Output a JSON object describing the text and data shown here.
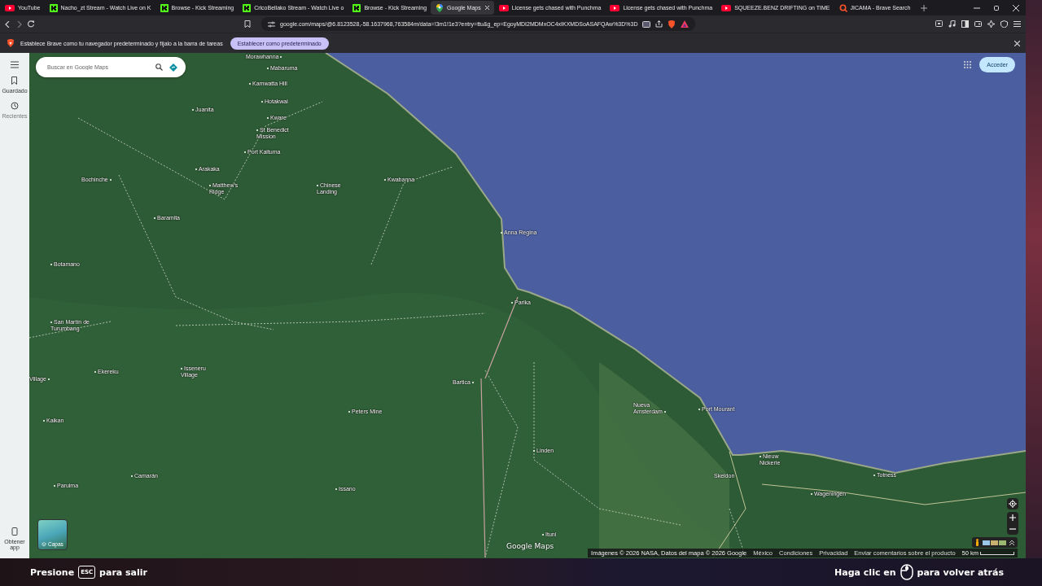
{
  "tabs": [
    {
      "label": "YouTube",
      "kind": "youtube",
      "selected": false
    },
    {
      "label": "Nacho_zt Stream - Watch Live on K",
      "kind": "kick",
      "selected": false
    },
    {
      "label": "Browse - Kick Streaming",
      "kind": "kick",
      "selected": false
    },
    {
      "label": "CricoBellako Stream - Watch Live o",
      "kind": "kick",
      "selected": false
    },
    {
      "label": "Browse - Kick Streaming",
      "kind": "kick",
      "selected": false
    },
    {
      "label": "Google Maps",
      "kind": "maps",
      "selected": true
    },
    {
      "label": "License gets chased with Punchma",
      "kind": "youtube",
      "selected": false
    },
    {
      "label": "License gets chased with Punchma",
      "kind": "youtube",
      "selected": false
    },
    {
      "label": "SQUEEZE.BENZ DRIFTING on TIME",
      "kind": "youtube",
      "selected": false
    },
    {
      "label": "JICAMA - Brave Search",
      "kind": "search",
      "selected": false
    }
  ],
  "address_bar": {
    "url": "google.com/maps/@6.8123528,-58.1637968,763584m/data=!3m1!1e3?entry=ttu&g_ep=EgoyMDI2MDMxOC4xIKXMDSoASAFQAw%3D%3D"
  },
  "infobar": {
    "message": "Establece Brave como tu navegador predeterminado y fíjalo a la barra de tareas",
    "button": "Establecer como predeterminado"
  },
  "maps": {
    "search": {
      "placeholder": "Buscar en Google Maps"
    },
    "sidebar": [
      {
        "label": "Guardado",
        "kind": "saved",
        "disabled": false
      },
      {
        "label": "Recientes",
        "kind": "recent",
        "disabled": true
      },
      {
        "label": "Obtener app",
        "kind": "app",
        "disabled": false
      }
    ],
    "sign_in": "Acceder",
    "layers": "Capas",
    "logo": "Google Maps",
    "places": [
      "Morawhanna",
      "Mabaruma",
      "Kamwatta Hill",
      "Hotakwai",
      "Kware",
      "St Benedict Mission",
      "Port Kaituma",
      "Juanita",
      "Arakaka",
      "Matthew's Ridge",
      "Chinese Landing",
      "Bochinche",
      "Baramita",
      "Kwabanna",
      "Anna Regina",
      "Botamano",
      "Parika",
      "San Martín de Turumbang",
      "Village",
      "Ekereku",
      "Isseneru Village",
      "Kaikan",
      "Peters Mine",
      "Bartica",
      "Linden",
      "Nueva Amsterdam",
      "Port Mourant",
      "Camarán",
      "Paruima",
      "Issano",
      "Ituni",
      "Skeldon",
      "Nieuw Nickerie",
      "Wageningen",
      "Totness"
    ],
    "attribution": "Imágenes © 2026 NASA, Datos del mapa © 2026 Google",
    "footer_links": [
      "México",
      "Condiciones",
      "Privacidad",
      "Enviar comentarios sobre el producto"
    ],
    "scale": "50 km"
  },
  "overlay": {
    "exit_prefix": "Presione",
    "exit_key": "ESC",
    "exit_suffix": "para salir",
    "back_prefix": "Haga clic en",
    "back_suffix": "para volver atrás"
  }
}
